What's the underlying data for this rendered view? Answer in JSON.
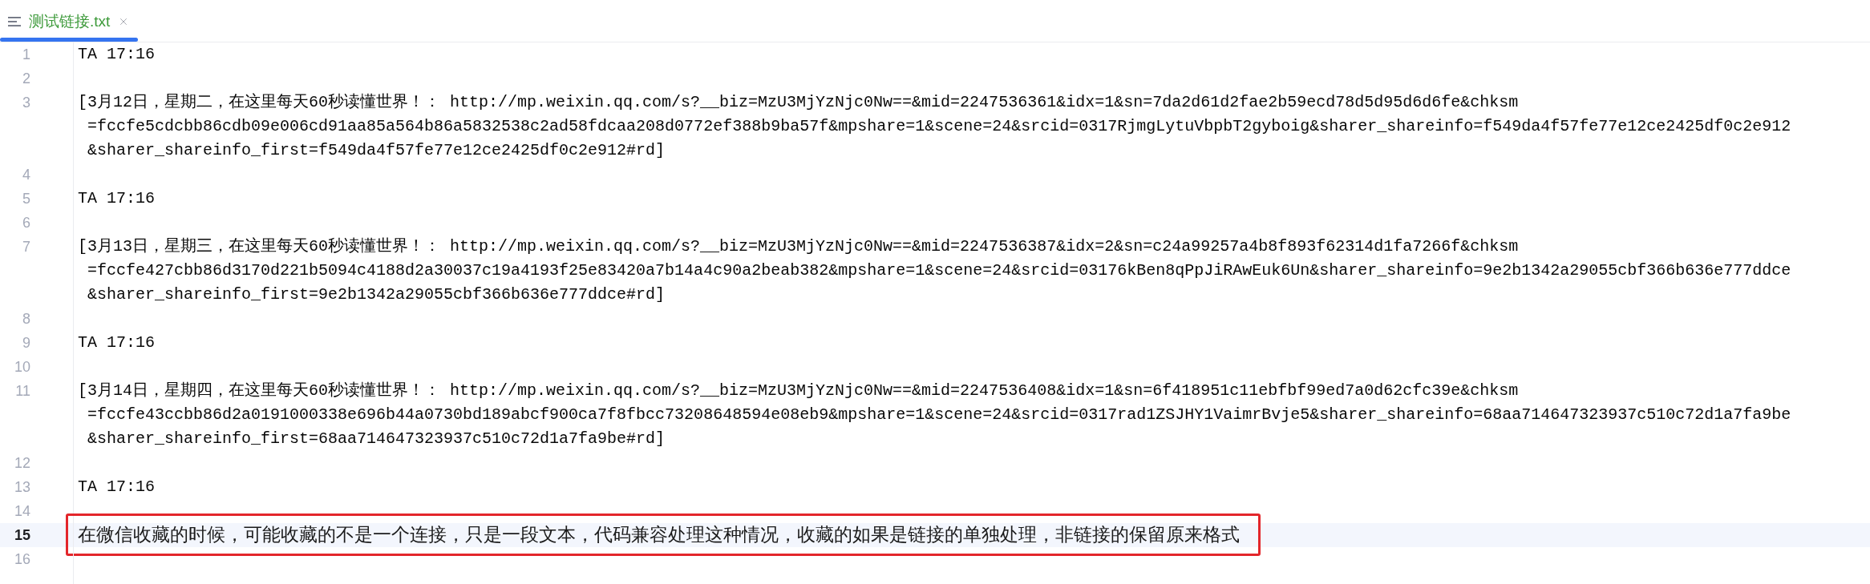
{
  "tabs": [
    {
      "label": "测试链接.txt",
      "selected": true
    }
  ],
  "editor": {
    "lines": [
      {
        "number": "1",
        "kind": "code",
        "rows": [
          "TA 17:16"
        ],
        "selected": false,
        "boxed": false
      },
      {
        "number": "2",
        "kind": "blank",
        "selected": false,
        "boxed": false
      },
      {
        "number": "3",
        "kind": "code",
        "rows": [
          "[3月12日，星期二，在这里每天60秒读懂世界！： http://mp.weixin.qq.com/s?__biz=MzU3MjYzNjc0Nw==&mid=2247536361&idx=1&sn=7da2d61d2fae2b59ecd78d5d95d6d6fe&chksm",
          "=fccfe5cdcbb86cdb09e006cd91aa85a564b86a5832538c2ad58fdcaa208d0772ef388b9ba57f&mpshare=1&scene=24&srcid=0317RjmgLytuVbpbT2gyboig&sharer_shareinfo=f549da4f57fe77e12ce2425df0c2e912",
          "&sharer_shareinfo_first=f549da4f57fe77e12ce2425df0c2e912#rd]"
        ],
        "selected": false,
        "boxed": false
      },
      {
        "number": "4",
        "kind": "blank",
        "selected": false,
        "boxed": false
      },
      {
        "number": "5",
        "kind": "code",
        "rows": [
          "TA 17:16"
        ],
        "selected": false,
        "boxed": false
      },
      {
        "number": "6",
        "kind": "blank",
        "selected": false,
        "boxed": false
      },
      {
        "number": "7",
        "kind": "code",
        "rows": [
          "[3月13日，星期三，在这里每天60秒读懂世界！： http://mp.weixin.qq.com/s?__biz=MzU3MjYzNjc0Nw==&mid=2247536387&idx=2&sn=c24a99257a4b8f893f62314d1fa7266f&chksm",
          "=fccfe427cbb86d3170d221b5094c4188d2a30037c19a4193f25e83420a7b14a4c90a2beab382&mpshare=1&scene=24&srcid=03176kBen8qPpJiRAwEuk6Un&sharer_shareinfo=9e2b1342a29055cbf366b636e777ddce",
          "&sharer_shareinfo_first=9e2b1342a29055cbf366b636e777ddce#rd]"
        ],
        "selected": false,
        "boxed": false
      },
      {
        "number": "8",
        "kind": "blank",
        "selected": false,
        "boxed": false
      },
      {
        "number": "9",
        "kind": "code",
        "rows": [
          "TA 17:16"
        ],
        "selected": false,
        "boxed": false
      },
      {
        "number": "10",
        "kind": "blank",
        "selected": false,
        "boxed": false
      },
      {
        "number": "11",
        "kind": "code",
        "rows": [
          "[3月14日，星期四，在这里每天60秒读懂世界！： http://mp.weixin.qq.com/s?__biz=MzU3MjYzNjc0Nw==&mid=2247536408&idx=1&sn=6f418951c11ebfbf99ed7a0d62cfc39e&chksm",
          "=fccfe43ccbb86d2a0191000338e696b44a0730bd189abcf900ca7f8fbcc73208648594e08eb9&mpshare=1&scene=24&srcid=0317rad1ZSJHY1VaimrBvje5&sharer_shareinfo=68aa714647323937c510c72d1a7fa9be",
          "&sharer_shareinfo_first=68aa714647323937c510c72d1a7fa9be#rd]"
        ],
        "selected": false,
        "boxed": false
      },
      {
        "number": "12",
        "kind": "blank",
        "selected": false,
        "boxed": false
      },
      {
        "number": "13",
        "kind": "code",
        "rows": [
          "TA 17:16"
        ],
        "selected": false,
        "boxed": false
      },
      {
        "number": "14",
        "kind": "blank",
        "selected": false,
        "boxed": false
      },
      {
        "number": "15",
        "kind": "prose",
        "rows": [
          "在微信收藏的时候，可能收藏的不是一个连接，只是一段文本，代码兼容处理这种情况，收藏的如果是链接的单独处理，非链接的保留原来格式"
        ],
        "selected": true,
        "boxed": true
      },
      {
        "number": "16",
        "kind": "blank",
        "selected": false,
        "boxed": false
      }
    ]
  }
}
